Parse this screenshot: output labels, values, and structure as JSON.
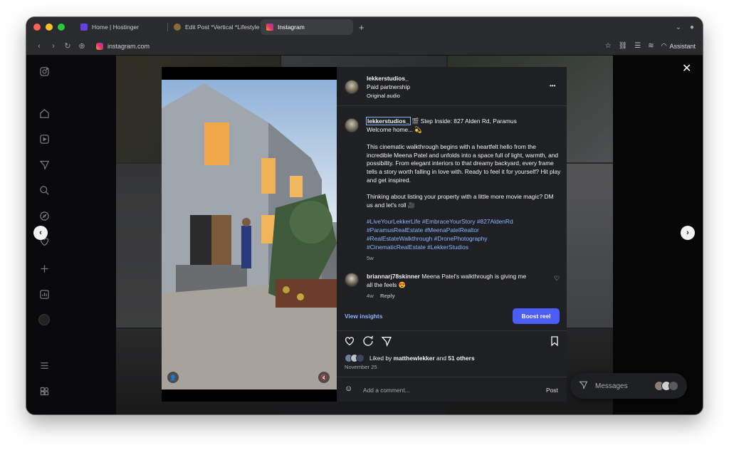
{
  "browser": {
    "tabs": [
      {
        "label": "Home | Hostinger",
        "active": false,
        "color": "#673de6"
      },
      {
        "label": "Edit Post *Vertical *Lifestyle",
        "active": false,
        "color": "#8a6a3a"
      },
      {
        "label": "Instagram",
        "active": true,
        "color": "#e2336b"
      }
    ],
    "new_tab": "+",
    "url": "instagram.com",
    "assistant_label": "Assistant"
  },
  "post": {
    "author": "lekkerstudios_",
    "paid_partnership": "Paid partnership",
    "audio": "Original audio",
    "more": "•••",
    "caption_title": "🎬 Step Inside: 827 Alden Rd, Paramus",
    "caption_welcome": "Welcome home... 💫",
    "caption_p1": "This cinematic walkthrough begins with a heartfelt hello from the incredible Meena Patel and unfolds into a space full of light, warmth, and possibility. From elegant interiors to that dreamy backyard, every frame tells a story worth falling in love with. Ready to feel it for yourself? Hit play and get inspired.",
    "caption_p2": "Thinking about listing your property with a little more movie magic? DM us and let's roll 🎥",
    "hashtags_l1": "#LiveYourLekkerLife #EmbraceYourStory #827AldenRd",
    "hashtags_l2": "#ParamusRealEstate #MeenaPatelRealtor",
    "hashtags_l3": "#RealEstateWalkthrough #DronePhotography",
    "hashtags_l4": "#CinematicRealEstate #LekkerStudios",
    "caption_age": "5w",
    "comment": {
      "user": "briannarj78skinner",
      "text_l1": "Meena Patel's walkthrough is giving me",
      "text_l2": "all the feels 😍",
      "age": "4w",
      "reply": "Reply"
    },
    "view_insights": "View insights",
    "boost": "Boost reel",
    "liked_by_prefix": "Liked by",
    "liked_by_user": "matthewlekker",
    "liked_by_and": "and",
    "liked_by_others": "51 others",
    "date": "November 25",
    "comment_placeholder": "Add a comment...",
    "post_button": "Post"
  },
  "messages": {
    "label": "Messages"
  }
}
